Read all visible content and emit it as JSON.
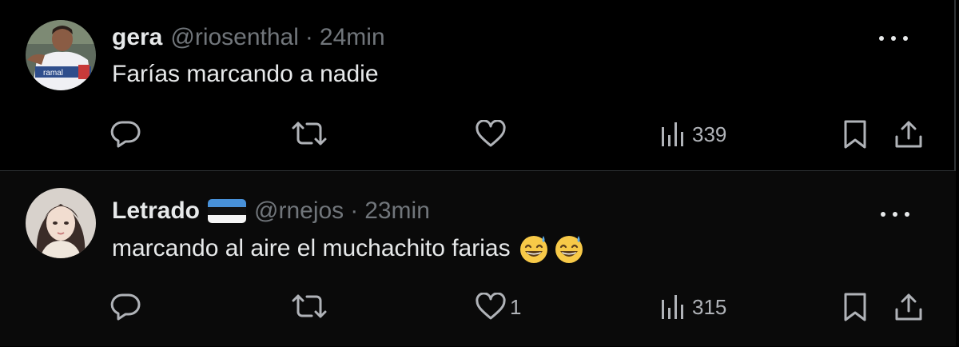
{
  "tweets": [
    {
      "name": "gera",
      "handle": "@riosenthal",
      "separator": "·",
      "time": "24min",
      "text": "Farías marcando a nadie",
      "avatar_icon": "profile-photo-player",
      "has_flag": false,
      "emojis": [],
      "likes": "",
      "views": "339"
    },
    {
      "name": "Letrado",
      "handle": "@rnejos",
      "separator": "·",
      "time": "23min",
      "text": "marcando al aire el muchachito farias",
      "avatar_icon": "profile-photo-woman",
      "has_flag": true,
      "flag_icon": "estonia-flag-emoji",
      "emojis": [
        "grinning-face-with-sweat",
        "grinning-face-with-sweat"
      ],
      "likes": "1",
      "views": "315"
    }
  ],
  "icons": {
    "reply": "speech-bubble-icon",
    "retweet": "retweet-arrows-icon",
    "like": "heart-icon",
    "views": "bar-chart-icon",
    "bookmark": "bookmark-icon",
    "share": "share-upload-icon",
    "more": "more-dots-icon"
  },
  "colors": {
    "background": "#000000",
    "text": "#e7e9ea",
    "secondary_text": "#71767b",
    "divider": "#2f3336"
  }
}
